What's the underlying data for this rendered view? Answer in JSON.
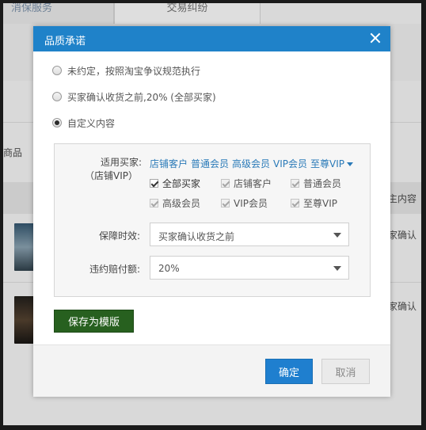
{
  "background": {
    "tab1": "消保服务",
    "tab2": "交易纠纷",
    "left_text": "商品",
    "right_header": "主内容",
    "row_text_1": "家确认",
    "row_text_2": "家确认"
  },
  "dialog": {
    "title": "品质承诺",
    "options": [
      {
        "label": "未约定，按照淘宝争议规范执行",
        "checked": false
      },
      {
        "label": "买家确认收货之前,20% (全部买家)",
        "checked": false
      },
      {
        "label": "自定义内容",
        "checked": true
      }
    ],
    "buyer_label": "适用买家:",
    "buyer_sublabel": "（店铺VIP）",
    "buyer_links": [
      "店铺客户",
      "普通会员",
      "高级会员",
      "VIP会员",
      "至尊VIP"
    ],
    "buyer_checkboxes": [
      {
        "label": "全部买家",
        "checked": true,
        "disabled": false
      },
      {
        "label": "店铺客户",
        "checked": true,
        "disabled": true
      },
      {
        "label": "普通会员",
        "checked": true,
        "disabled": true
      },
      {
        "label": "高级会员",
        "checked": true,
        "disabled": true
      },
      {
        "label": "VIP会员",
        "checked": true,
        "disabled": true
      },
      {
        "label": "至尊VIP",
        "checked": true,
        "disabled": true
      }
    ],
    "period_label": "保障时效:",
    "period_value": "买家确认收货之前",
    "compensation_label": "违约赔付额:",
    "compensation_value": "20%",
    "save_template": "保存为模版",
    "ok": "确定",
    "cancel": "取消"
  },
  "colors": {
    "header": "#1f82c9",
    "link": "#2a7ab8",
    "save_template": "#27601f",
    "ok": "#1f7fcf"
  },
  "icons": [
    "close-icon",
    "chevron-down-icon",
    "checkmark-icon",
    "radio-icon"
  ]
}
